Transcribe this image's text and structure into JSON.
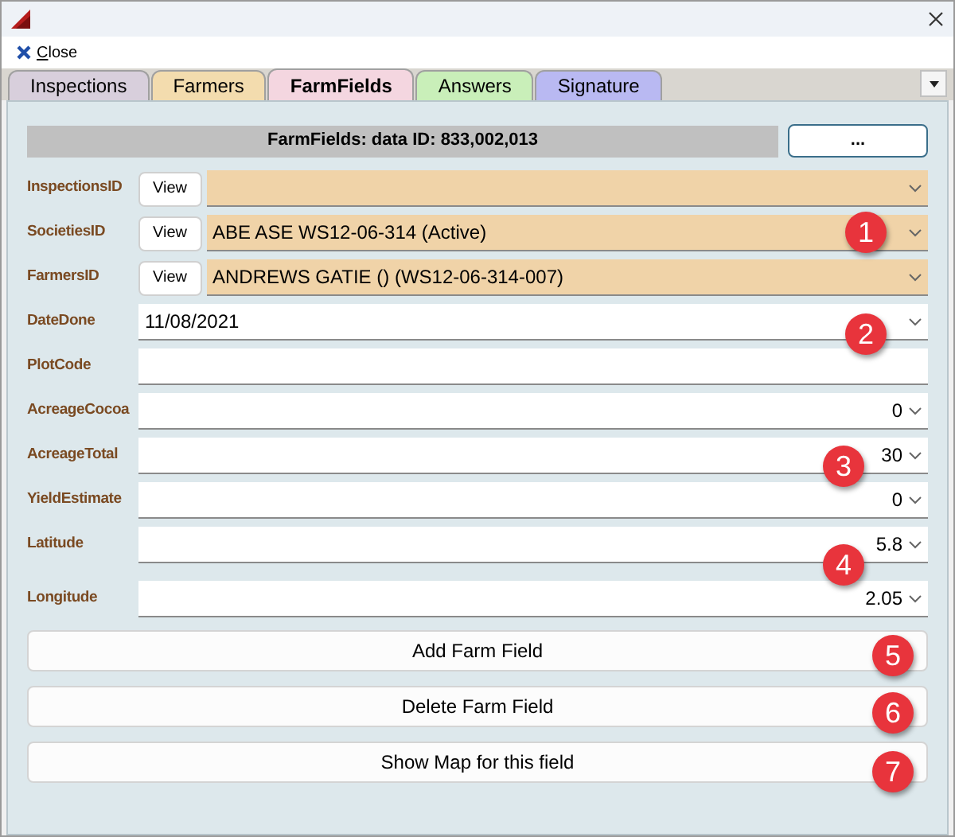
{
  "menu": {
    "close": "Close"
  },
  "tabs": [
    {
      "label": "Inspections",
      "color": "#d8cfdc",
      "selected": false
    },
    {
      "label": "Farmers",
      "color": "#f3dcae",
      "selected": false
    },
    {
      "label": "FarmFields",
      "color": "#f4d6e0",
      "selected": true
    },
    {
      "label": "Answers",
      "color": "#c9efb9",
      "selected": false
    },
    {
      "label": "Signature",
      "color": "#b9b9f2",
      "selected": false
    }
  ],
  "header": {
    "title": "FarmFields: data ID: 833,002,013",
    "button": "..."
  },
  "fields": [
    {
      "label": "InspectionsID",
      "kind": "lookup",
      "button": "View"
    },
    {
      "label": "SocietiesID",
      "kind": "lookup",
      "button": "View",
      "value": "ABE ASE WS12-06-314 (Active)"
    },
    {
      "label": "FarmersID",
      "kind": "lookup",
      "button": "View",
      "value": "ANDREWS GATIE  () (WS12-06-314-007)"
    },
    {
      "label": "DateDone",
      "kind": "date",
      "value": "11/08/2021"
    },
    {
      "label": "PlotCode",
      "kind": "text"
    },
    {
      "label": "AcreageCocoa",
      "kind": "number",
      "value": "0"
    },
    {
      "label": "AcreageTotal",
      "kind": "number",
      "value": "30"
    },
    {
      "label": "YieldEstimate",
      "kind": "number",
      "value": "0"
    },
    {
      "label": "Latitude",
      "kind": "number",
      "value": "5.8"
    },
    {
      "label": "Longitude",
      "kind": "number",
      "value": "2.05"
    }
  ],
  "buttons": [
    "Add Farm Field",
    "Delete Farm Field",
    "Show Map for this field"
  ],
  "badges": [
    "1",
    "2",
    "3",
    "4",
    "5",
    "6",
    "7"
  ]
}
